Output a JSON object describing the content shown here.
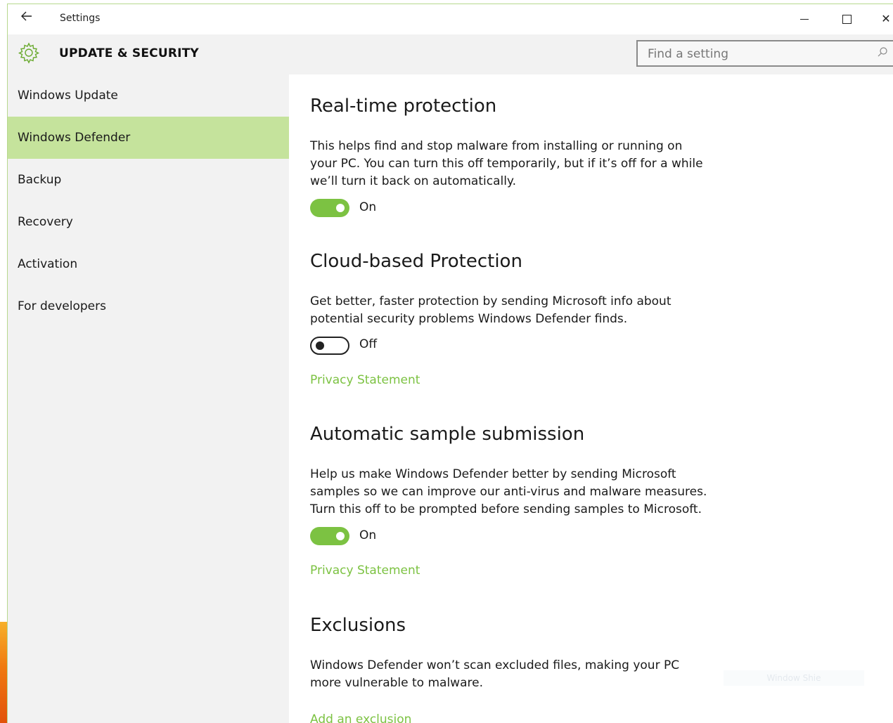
{
  "window": {
    "app_title": "Settings",
    "back_icon": "back-arrow-icon",
    "controls": {
      "minimize": "minimize-icon",
      "maximize": "maximize-icon",
      "close": "✕"
    }
  },
  "header": {
    "icon": "gear-icon",
    "title": "UPDATE & SECURITY",
    "search": {
      "placeholder": "Find a setting",
      "icon": "search-icon"
    }
  },
  "sidebar": {
    "items": [
      {
        "label": "Windows Update"
      },
      {
        "label": "Windows Defender",
        "active": true
      },
      {
        "label": "Backup"
      },
      {
        "label": "Recovery"
      },
      {
        "label": "Activation"
      },
      {
        "label": "For developers"
      }
    ]
  },
  "sections": {
    "realtime": {
      "title": "Real-time protection",
      "description": "This helps find and stop malware from installing or running on your PC. You can turn this off temporarily, but if it’s off for a while we’ll turn it back on automatically.",
      "toggle_state": "On"
    },
    "cloud": {
      "title": "Cloud-based Protection",
      "description": "Get better, faster protection by sending Microsoft info about potential security problems Windows Defender finds.",
      "toggle_state": "Off",
      "link": "Privacy Statement"
    },
    "sample": {
      "title": "Automatic sample submission",
      "description": "Help us make Windows Defender better by sending Microsoft samples so we can improve our anti-virus  and malware measures. Turn this off to be prompted before sending samples to Microsoft.",
      "toggle_state": "On",
      "link": "Privacy Statement"
    },
    "exclusions": {
      "title": "Exclusions",
      "description": "Windows Defender won’t scan excluded files, making your PC more vulnerable to malware.",
      "link": "Add an exclusion"
    }
  },
  "watermark": "Window Shie",
  "colors": {
    "accent": "#7cc242",
    "nav_active": "#c5e39c",
    "sidebar_bg": "#f2f2f2",
    "toggle_off_border": "#222222"
  }
}
